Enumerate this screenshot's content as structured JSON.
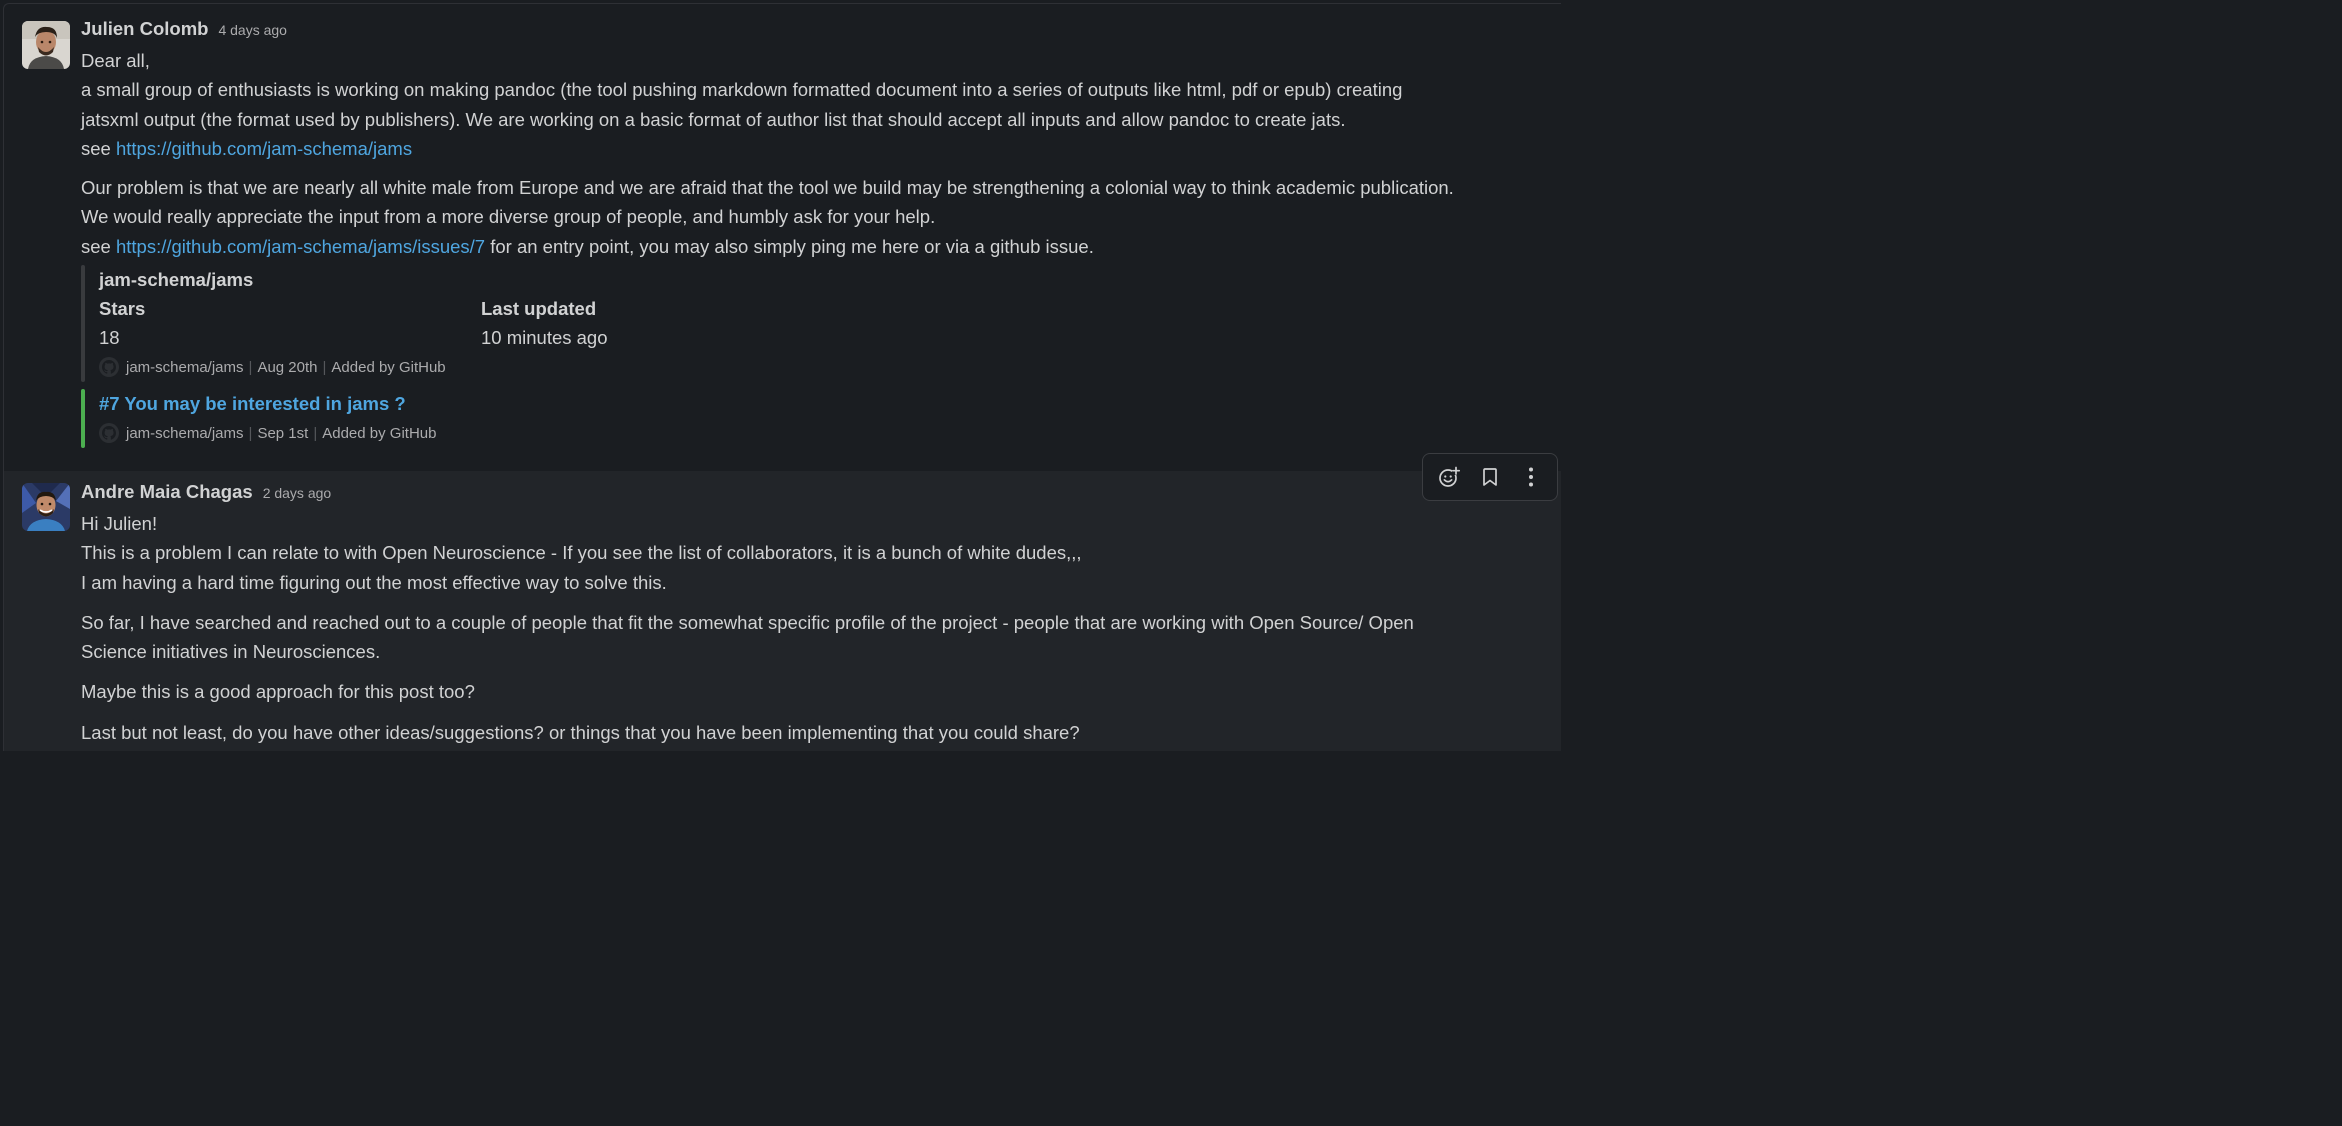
{
  "messages": [
    {
      "author": "Julien Colomb",
      "time": "4 days ago",
      "lines": {
        "greeting": "Dear all,",
        "p1_a": "a small group of enthusiasts is working on making pandoc (the tool pushing markdown formatted document into a series of outputs like html, pdf or epub) creating",
        "p1_b": "jatsxml output (the format used by publishers). We are working on a basic format of author list that should accept all inputs and allow pandoc to create jats.",
        "see": "see ",
        "link1": "https://github.com/jam-schema/jams",
        "p2_a": "Our problem is that we are nearly all white male from Europe and we are afraid that the tool we build may be strengthening a colonial way to think academic publication.",
        "p2_b": "We would really appreciate the input from a more diverse group of people, and humbly ask for your help.",
        "see2": "see ",
        "link2": "https://github.com/jam-schema/jams/issues/7",
        "p2_c": " for an entry point, you may also simply ping me here or via a github issue."
      },
      "unfurl_repo": {
        "title": "jam-schema/jams",
        "stars_label": "Stars",
        "stars_value": "18",
        "updated_label": "Last updated",
        "updated_value": "10 minutes ago",
        "footer_repo": "jam-schema/jams",
        "footer_date": "Aug 20th",
        "footer_added": "Added by GitHub"
      },
      "unfurl_issue": {
        "title": "#7 You may be interested in jams ?",
        "footer_repo": "jam-schema/jams",
        "footer_date": "Sep 1st",
        "footer_added": "Added by GitHub"
      }
    },
    {
      "author": "Andre Maia Chagas",
      "time": "2 days ago",
      "lines": {
        "l1": "Hi Julien!",
        "l2": "This is a problem I can relate to with Open Neuroscience - If you see the list of collaborators, it is a bunch of white dudes,,,",
        "l3": "I am having a hard time figuring out the most effective way to solve this.",
        "p2_a": "So far, I have searched and reached out to a couple of people that fit the somewhat specific profile of the project - people that are working with Open Source/ Open",
        "p2_b": "Science initiatives in Neurosciences.",
        "p3": "Maybe this is a good approach for this post too?",
        "p4": "Last but not least, do you have other ideas/suggestions? or things that you have been implementing that you could share?"
      }
    }
  ],
  "toolbar": {
    "icons": [
      "add-reaction-icon",
      "bookmark-icon",
      "more-actions-icon"
    ]
  },
  "colors": {
    "background": "#1a1d21",
    "hover_background": "#222529",
    "link": "#4fa6e0",
    "text": "#d1d2d3",
    "muted": "#ababad",
    "issue_bar": "#4caf50"
  }
}
